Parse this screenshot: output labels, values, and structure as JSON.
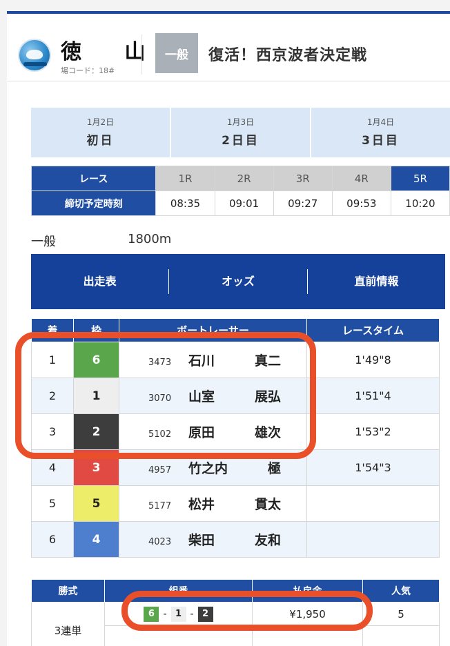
{
  "header": {
    "venue_name": "徳 山",
    "venue_code": "場コード：18#",
    "grade": "一般",
    "race_title": "復活！西京波者決定戦"
  },
  "days": [
    {
      "date": "1月2日",
      "label": "初日"
    },
    {
      "date": "1月3日",
      "label": "2日目"
    },
    {
      "date": "1月4日",
      "label": "3日目"
    }
  ],
  "schedule": {
    "race_label": "レース",
    "deadline_label": "締切予定時刻",
    "races": [
      "1R",
      "2R",
      "3R",
      "4R",
      "5R"
    ],
    "times": [
      "08:35",
      "09:01",
      "09:27",
      "09:53",
      "10:20"
    ],
    "active_index": 4
  },
  "race_info": {
    "grade": "一般",
    "distance": "1800m"
  },
  "nav": {
    "entries": "出走表",
    "odds": "オッズ",
    "pre_info": "直前情報"
  },
  "results": {
    "headers": [
      "着",
      "枠",
      "ボートレーサー",
      "レースタイム"
    ],
    "rows": [
      {
        "place": "1",
        "frame": "6",
        "reg": "3473",
        "family": "石川",
        "given": "真二",
        "time": "1'49\"8"
      },
      {
        "place": "2",
        "frame": "1",
        "reg": "3070",
        "family": "山室",
        "given": "展弘",
        "time": "1'51\"4"
      },
      {
        "place": "3",
        "frame": "2",
        "reg": "5102",
        "family": "原田",
        "given": "雄次",
        "time": "1'53\"2"
      },
      {
        "place": "4",
        "frame": "3",
        "reg": "4957",
        "family": "竹之内",
        "given": "極",
        "time": "1'54\"3"
      },
      {
        "place": "5",
        "frame": "5",
        "reg": "5177",
        "family": "松井",
        "given": "貫太",
        "time": ""
      },
      {
        "place": "6",
        "frame": "4",
        "reg": "4023",
        "family": "柴田",
        "given": "友和",
        "time": ""
      }
    ]
  },
  "payout": {
    "headers": [
      "勝式",
      "組番",
      "払戻金",
      "人気"
    ],
    "bet_type": "3連単",
    "combo": [
      "6",
      "1",
      "2"
    ],
    "dash": "-",
    "amount": "¥1,950",
    "popularity": "5"
  },
  "colors": {
    "frame_1": "#eeeeee",
    "frame_2": "#3d3d3d",
    "frame_3": "#e04a43",
    "frame_4": "#4e7fcf",
    "frame_5": "#eded6a",
    "frame_6": "#5aa64b",
    "accent": "#1f4ea2",
    "highlight": "#e9502a"
  }
}
